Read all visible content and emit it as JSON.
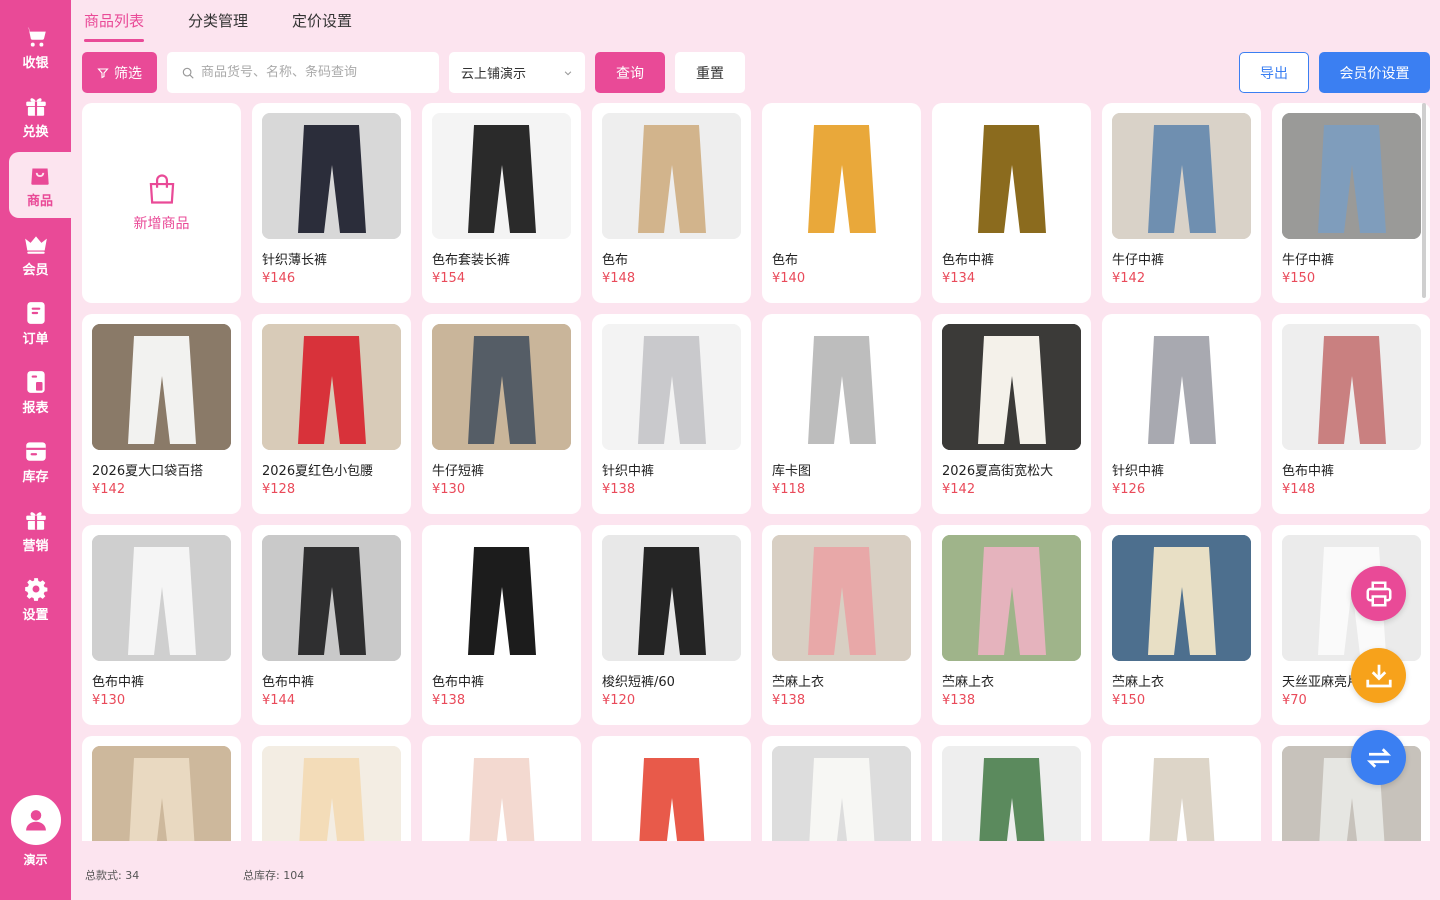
{
  "sidebar": {
    "items": [
      {
        "label": "收银",
        "icon": "cart-icon"
      },
      {
        "label": "兑换",
        "icon": "gift-icon"
      },
      {
        "label": "商品",
        "icon": "shopping-bag-icon"
      },
      {
        "label": "会员",
        "icon": "crown-icon"
      },
      {
        "label": "订单",
        "icon": "document-icon"
      },
      {
        "label": "报表",
        "icon": "report-icon"
      },
      {
        "label": "库存",
        "icon": "inventory-icon"
      },
      {
        "label": "营销",
        "icon": "present-icon"
      },
      {
        "label": "设置",
        "icon": "gear-icon"
      }
    ],
    "active": "商品",
    "user": {
      "name": "演示"
    }
  },
  "tabs": [
    {
      "label": "商品列表",
      "active": true
    },
    {
      "label": "分类管理",
      "active": false
    },
    {
      "label": "定价设置",
      "active": false
    }
  ],
  "toolbar": {
    "filter_label": "筛选",
    "search_placeholder": "商品货号、名称、条码查询",
    "store_value": "云上铺演示",
    "query_label": "查询",
    "reset_label": "重置",
    "export_label": "导出",
    "member_price_label": "会员价设置"
  },
  "add_product_label": "新增商品",
  "products": [
    {
      "name": "针织薄长裤",
      "price": "¥146",
      "palette": [
        "#d8d8d8",
        "#2b2d3a"
      ]
    },
    {
      "name": "色布套装长裤",
      "price": "¥154",
      "palette": [
        "#f4f4f4",
        "#2a2a2a"
      ]
    },
    {
      "name": "色布",
      "price": "¥148",
      "palette": [
        "#eeeeee",
        "#d2b48c"
      ]
    },
    {
      "name": "色布",
      "price": "¥140",
      "palette": [
        "#ffffff",
        "#e9a83a"
      ]
    },
    {
      "name": "色布中裤",
      "price": "¥134",
      "palette": [
        "#ffffff",
        "#8b6b1e"
      ]
    },
    {
      "name": "牛仔中裤",
      "price": "¥142",
      "palette": [
        "#d9d2c8",
        "#6f8fb0"
      ]
    },
    {
      "name": "牛仔中裤",
      "price": "¥150",
      "palette": [
        "#9a9a98",
        "#7f9dbc"
      ]
    },
    {
      "name": "2026夏大口袋百搭",
      "price": "¥142",
      "palette": [
        "#8a7a68",
        "#f2f2f0"
      ]
    },
    {
      "name": "2026夏红色小包腰",
      "price": "¥128",
      "palette": [
        "#d8cbb8",
        "#d8323a"
      ]
    },
    {
      "name": "牛仔短裤",
      "price": "¥130",
      "palette": [
        "#c9b59a",
        "#555d66"
      ]
    },
    {
      "name": "针织中裤",
      "price": "¥138",
      "palette": [
        "#f3f3f3",
        "#c9c9cc"
      ]
    },
    {
      "name": "库卡图",
      "price": "¥118",
      "palette": [
        "#ffffff",
        "#bdbdbd"
      ]
    },
    {
      "name": "2026夏高街宽松大",
      "price": "¥142",
      "palette": [
        "#3b3a38",
        "#f4f1ea"
      ]
    },
    {
      "name": "针织中裤",
      "price": "¥126",
      "palette": [
        "#ffffff",
        "#a8a9b0"
      ]
    },
    {
      "name": "色布中裤",
      "price": "¥148",
      "palette": [
        "#eeeeee",
        "#c98080"
      ]
    },
    {
      "name": "色布中裤",
      "price": "¥130",
      "palette": [
        "#cfcfcf",
        "#f5f5f5"
      ]
    },
    {
      "name": "色布中裤",
      "price": "¥144",
      "palette": [
        "#c9c9c9",
        "#2f2f30"
      ]
    },
    {
      "name": "色布中裤",
      "price": "¥138",
      "palette": [
        "#ffffff",
        "#1c1c1c"
      ]
    },
    {
      "name": "梭织短裤/60",
      "price": "¥120",
      "palette": [
        "#e8e8e8",
        "#252525"
      ]
    },
    {
      "name": "苎麻上衣",
      "price": "¥138",
      "palette": [
        "#d8cfc3",
        "#e8a8a8"
      ]
    },
    {
      "name": "苎麻上衣",
      "price": "¥138",
      "palette": [
        "#9fb48a",
        "#e5b3bd"
      ]
    },
    {
      "name": "苎麻上衣",
      "price": "¥150",
      "palette": [
        "#4d6f8e",
        "#e8dfc5"
      ]
    },
    {
      "name": "天丝亚麻亮片",
      "price": "¥70",
      "palette": [
        "#ebebeb",
        "#fafafa"
      ]
    },
    {
      "name": "",
      "price": "",
      "palette": [
        "#cdb89c",
        "#e9d9c1"
      ]
    },
    {
      "name": "",
      "price": "",
      "palette": [
        "#f3ede3",
        "#f3dcb8"
      ]
    },
    {
      "name": "",
      "price": "",
      "palette": [
        "#ffffff",
        "#f3d9d0"
      ]
    },
    {
      "name": "",
      "price": "",
      "palette": [
        "#ffffff",
        "#e85a4a"
      ]
    },
    {
      "name": "",
      "price": "",
      "palette": [
        "#dddddd",
        "#f7f7f4"
      ]
    },
    {
      "name": "",
      "price": "",
      "palette": [
        "#eeeeee",
        "#5b8a5d"
      ]
    },
    {
      "name": "",
      "price": "",
      "palette": [
        "#ffffff",
        "#ddd5c8"
      ]
    },
    {
      "name": "",
      "price": "",
      "palette": [
        "#c7c2bb",
        "#e6e6e2"
      ]
    }
  ],
  "footer": {
    "total_styles_label": "总款式: 34",
    "total_stock_label": "总库存: 104"
  },
  "colors": {
    "brand": "#e94a97",
    "accent_blue": "#3b7ff2",
    "fab_orange": "#f7a21b",
    "price_red": "#e94a5a"
  }
}
